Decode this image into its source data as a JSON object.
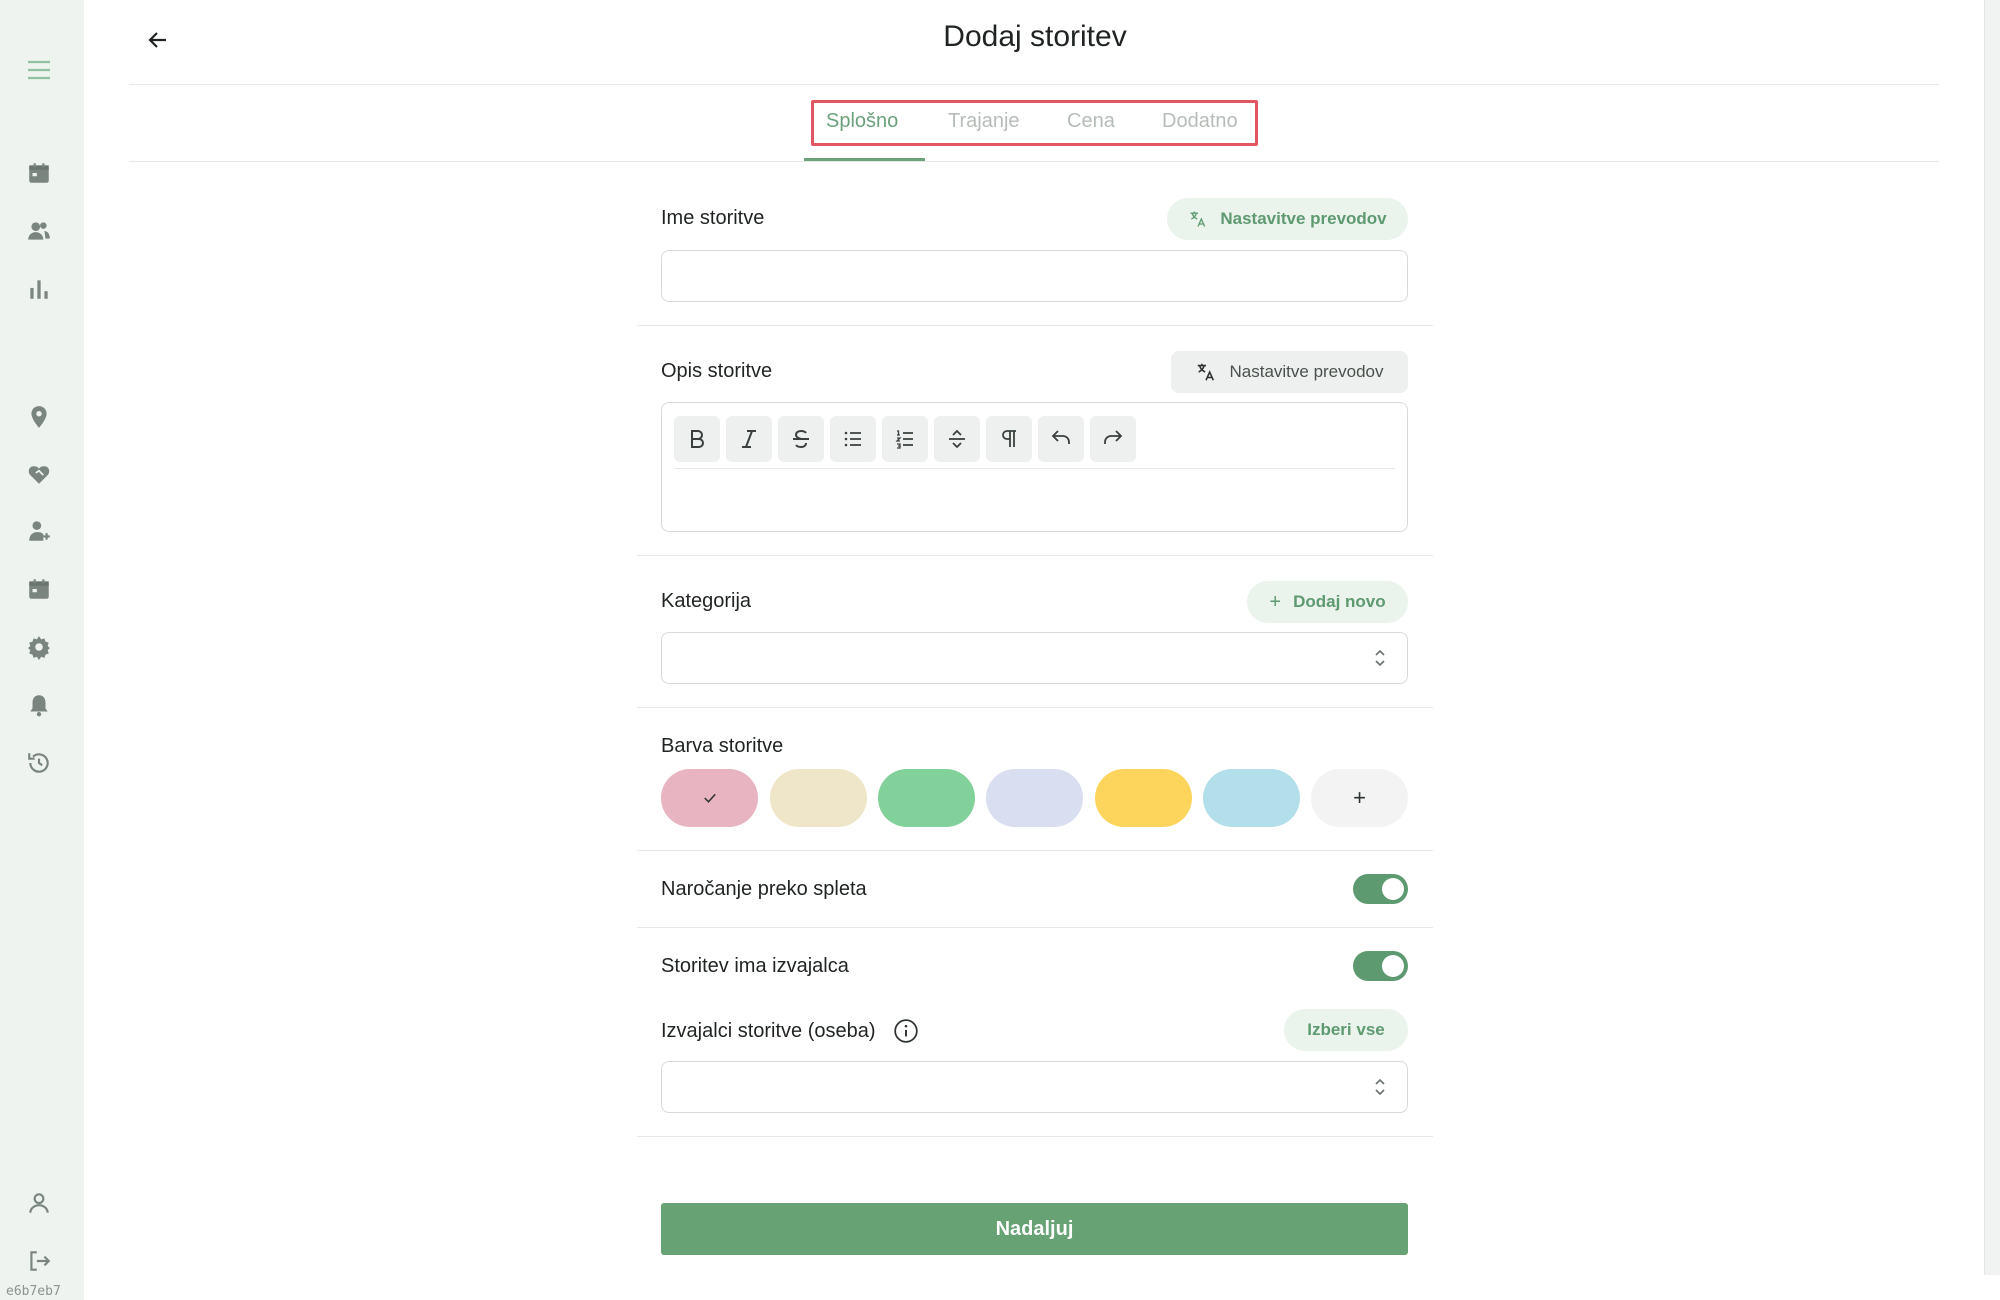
{
  "header": {
    "title": "Dodaj storitev",
    "back_icon": "arrow-left-icon"
  },
  "tabs": [
    {
      "label": "Splošno",
      "active": true
    },
    {
      "label": "Trajanje",
      "active": false
    },
    {
      "label": "Cena",
      "active": false
    },
    {
      "label": "Dodatno",
      "active": false
    }
  ],
  "sidebar": {
    "version": "e6b7eb7",
    "icons": [
      "menu-icon",
      "calendar-icon",
      "users-icon",
      "bar-chart-icon",
      "location-pin-icon",
      "handshake-icon",
      "user-plus-icon",
      "calendar-icon",
      "gear-icon",
      "bell-icon",
      "history-icon",
      "profile-icon",
      "logout-icon"
    ]
  },
  "form": {
    "name": {
      "label": "Ime storitve",
      "translate_label": "Nastavitve prevodov",
      "value": ""
    },
    "description": {
      "label": "Opis storitve",
      "translate_label": "Nastavitve prevodov",
      "value": ""
    },
    "category": {
      "label": "Kategorija",
      "add_label": "Dodaj novo",
      "value": ""
    },
    "color": {
      "label": "Barva storitve",
      "swatches": [
        "#e8b4c1",
        "#efe6c9",
        "#82d19a",
        "#d9def0",
        "#fdd55c",
        "#b3dfeb"
      ],
      "selected_index": 0,
      "add_symbol": "+"
    },
    "online_booking": {
      "label": "Naročanje preko spleta",
      "enabled": true
    },
    "has_provider": {
      "label": "Storitev ima izvajalca",
      "enabled": true
    },
    "providers": {
      "label": "Izvajalci storitve (oseba)",
      "select_all_label": "Izberi vse",
      "value": ""
    }
  },
  "submit_label": "Nadaljuj",
  "colors": {
    "accent": "#67a274",
    "tab_highlight_border": "#e25563"
  }
}
